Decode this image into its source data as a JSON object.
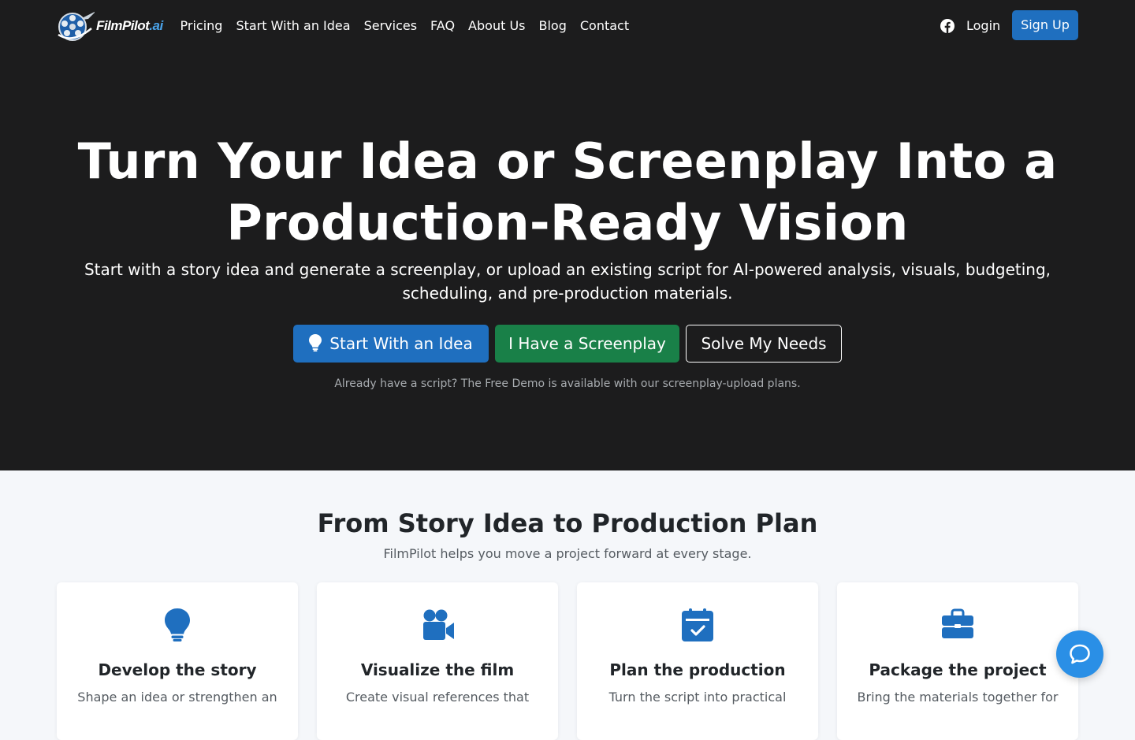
{
  "brand": {
    "name_part1": "FilmPilot",
    "name_part2": ".ai"
  },
  "nav": {
    "links": [
      "Pricing",
      "Start With an Idea",
      "Services",
      "FAQ",
      "About Us",
      "Blog",
      "Contact"
    ],
    "login": "Login",
    "signup": "Sign Up"
  },
  "hero": {
    "title_line1": "Turn Your Idea or Screenplay Into a",
    "title_line2": "Production-Ready Vision",
    "subtitle": "Start with a story idea and generate a screenplay, or upload an existing script for AI-powered analysis, visuals, budgeting, scheduling, and pre-production materials.",
    "buttons": {
      "idea": "Start With an Idea",
      "screenplay": "I Have a Screenplay",
      "needs": "Solve My Needs"
    },
    "note": "Already have a script? The Free Demo is available with our screenplay-upload plans."
  },
  "features": {
    "title": "From Story Idea to Production Plan",
    "subtitle": "FilmPilot helps you move a project forward at every stage.",
    "cards": [
      {
        "icon": "lightbulb-icon",
        "title": "Develop the story",
        "desc": "Shape an idea or strengthen an"
      },
      {
        "icon": "video-camera-icon",
        "title": "Visualize the film",
        "desc": "Create visual references that"
      },
      {
        "icon": "calendar-check-icon",
        "title": "Plan the production",
        "desc": "Turn the script into practical"
      },
      {
        "icon": "briefcase-icon",
        "title": "Package the project",
        "desc": "Bring the materials together for"
      }
    ]
  },
  "colors": {
    "hero_bg": "#1c1c1d",
    "primary_blue": "#1f6fbf",
    "success_green": "#198048",
    "section_bg": "#f5f7fa",
    "chat_blue": "#2a8fe6"
  }
}
